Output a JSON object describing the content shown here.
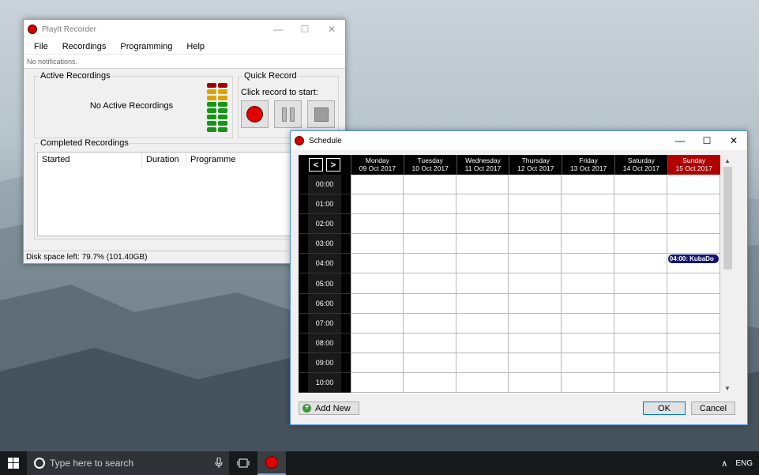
{
  "main_window": {
    "title": "PlayIt Recorder",
    "menu": [
      "File",
      "Recordings",
      "Programming",
      "Help"
    ],
    "notification": "No notifications.",
    "active_recordings": {
      "label": "Active Recordings",
      "empty_text": "No Active Recordings"
    },
    "quick_record": {
      "label": "Quick Record",
      "hint": "Click record to start:"
    },
    "completed_recordings": {
      "label": "Completed Recordings",
      "columns": [
        "Started",
        "Duration",
        "Programme"
      ]
    },
    "status": "Disk space left: 79.7% (101.40GB)",
    "colors": {
      "record_red": "#e00000",
      "vu_red": "#a40000",
      "vu_yellow": "#d9a400",
      "vu_green": "#159615"
    }
  },
  "schedule_window": {
    "title": "Schedule",
    "nav": {
      "prev": "<",
      "next": ">"
    },
    "days": [
      {
        "name": "Monday",
        "date": "09 Oct 2017",
        "today": false
      },
      {
        "name": "Tuesday",
        "date": "10 Oct 2017",
        "today": false
      },
      {
        "name": "Wednesday",
        "date": "11 Oct 2017",
        "today": false
      },
      {
        "name": "Thursday",
        "date": "12 Oct 2017",
        "today": false
      },
      {
        "name": "Friday",
        "date": "13 Oct 2017",
        "today": false
      },
      {
        "name": "Saturday",
        "date": "14 Oct 2017",
        "today": false
      },
      {
        "name": "Sunday",
        "date": "15 Oct 2017",
        "today": true
      }
    ],
    "times": [
      "00:00",
      "01:00",
      "02:00",
      "03:00",
      "04:00",
      "05:00",
      "06:00",
      "07:00",
      "08:00",
      "09:00",
      "10:00"
    ],
    "events": [
      {
        "day_index": 6,
        "time_index": 4,
        "label": "04:00: KubaDo"
      }
    ],
    "buttons": {
      "add_new": "Add New",
      "ok": "OK",
      "cancel": "Cancel"
    },
    "colors": {
      "today_header": "#b00000",
      "event_bg": "#14146e"
    }
  },
  "taskbar": {
    "search_placeholder": "Type here to search",
    "language": "ENG"
  }
}
